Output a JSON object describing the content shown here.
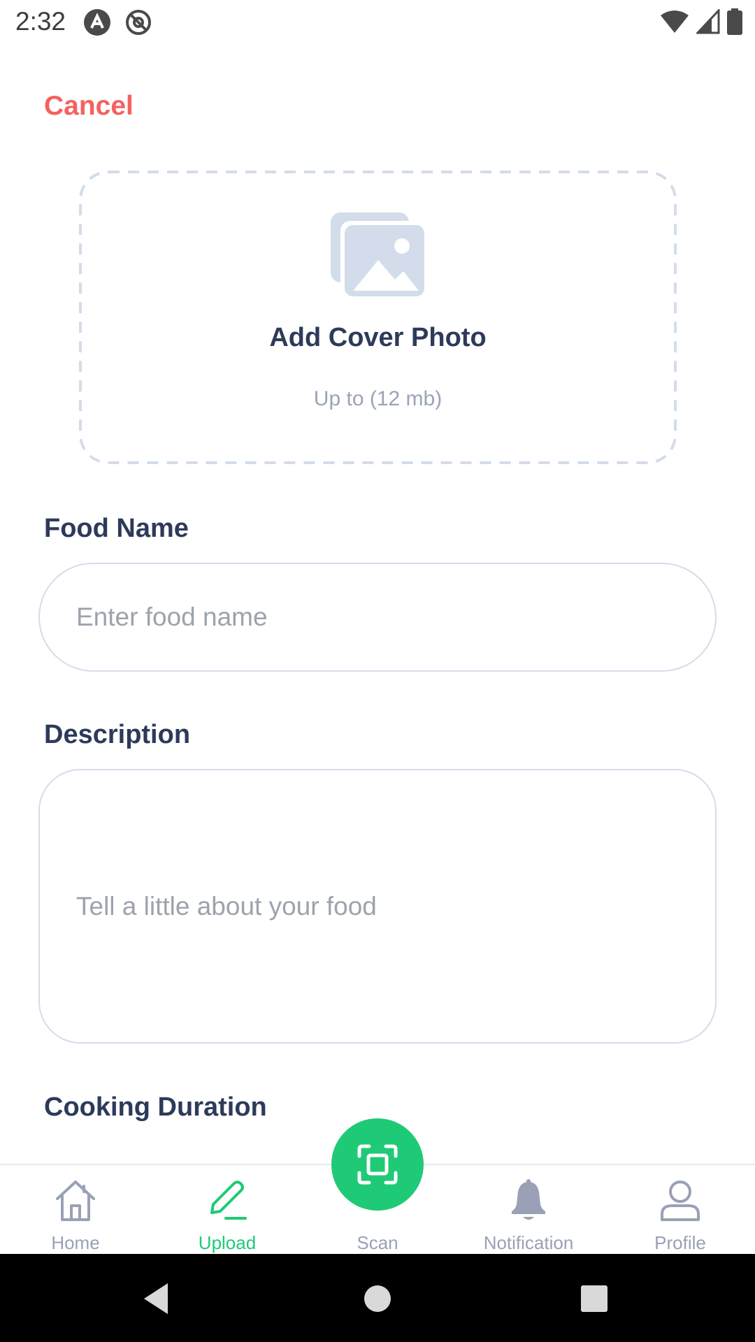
{
  "status_bar": {
    "time": "2:32"
  },
  "header": {
    "cancel_label": "Cancel"
  },
  "cover_photo": {
    "title": "Add Cover Photo",
    "subtitle": "Up to (12 mb)",
    "icon": "image-icon"
  },
  "form": {
    "food_name": {
      "label": "Food Name",
      "placeholder": "Enter food name",
      "value": ""
    },
    "description": {
      "label": "Description",
      "placeholder": "Tell a little about your food",
      "value": ""
    },
    "cooking_duration": {
      "label": "Cooking Duration"
    }
  },
  "bottom_nav": {
    "items": [
      {
        "label": "Home",
        "icon": "home-icon",
        "active": false
      },
      {
        "label": "Upload",
        "icon": "pencil-icon",
        "active": true
      },
      {
        "label": "Scan",
        "icon": "scan-icon",
        "active": false
      },
      {
        "label": "Notification",
        "icon": "bell-icon",
        "active": false
      },
      {
        "label": "Profile",
        "icon": "user-icon",
        "active": false
      }
    ]
  },
  "colors": {
    "accent": "#1fca76",
    "cancel": "#f5615e",
    "heading": "#2d3a5a",
    "muted": "#9aa0b6"
  }
}
